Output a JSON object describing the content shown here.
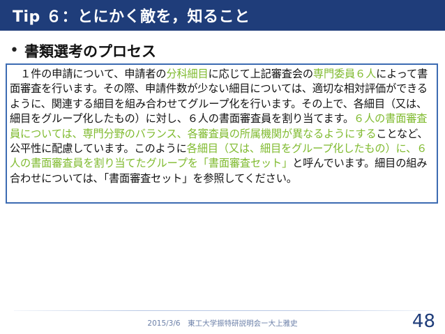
{
  "slide": {
    "title": "Tip ６：とにかく敵を，知ること",
    "bullet": "書類選考のプロセス",
    "body_segments": [
      {
        "text": "　１件の申請について、申請者の",
        "highlight": false
      },
      {
        "text": "分科細目",
        "highlight": true
      },
      {
        "text": "に応じて上記審査会の",
        "highlight": false
      },
      {
        "text": "専門委員６人",
        "highlight": true
      },
      {
        "text": "によって書面審査を行います。その際、申請件数が少ない細目については、適切な相対評価ができるように、関連する細目を組み合わせてグループ化を行います。その上で、各細目（又は、細目をグループ化したもの）に対し、６人の書面審査員を割り当てます。",
        "highlight": false
      },
      {
        "text": "６人の書面審査員については、専門分野のバランス、各審査員の所属機関が異なるようにする",
        "highlight": true
      },
      {
        "text": "ことなど、公平性に配慮しています。このように",
        "highlight": false
      },
      {
        "text": "各細目（又は、細目をグループ化したもの）に、６人の書面審査員を割り当てたグループを「書面審査セット」",
        "highlight": true
      },
      {
        "text": "と呼んでいます。細目の組み合わせについては、「書面審査セット」を参照してください。",
        "highlight": false
      }
    ]
  },
  "footer": {
    "text": "2015/3/6　東工大学振特研説明会ー大上雅史",
    "page_number": "48"
  },
  "colors": {
    "title_bar": "#1f3d7a",
    "highlight": "#7fba2e",
    "box_border": "#3c6bb2"
  }
}
